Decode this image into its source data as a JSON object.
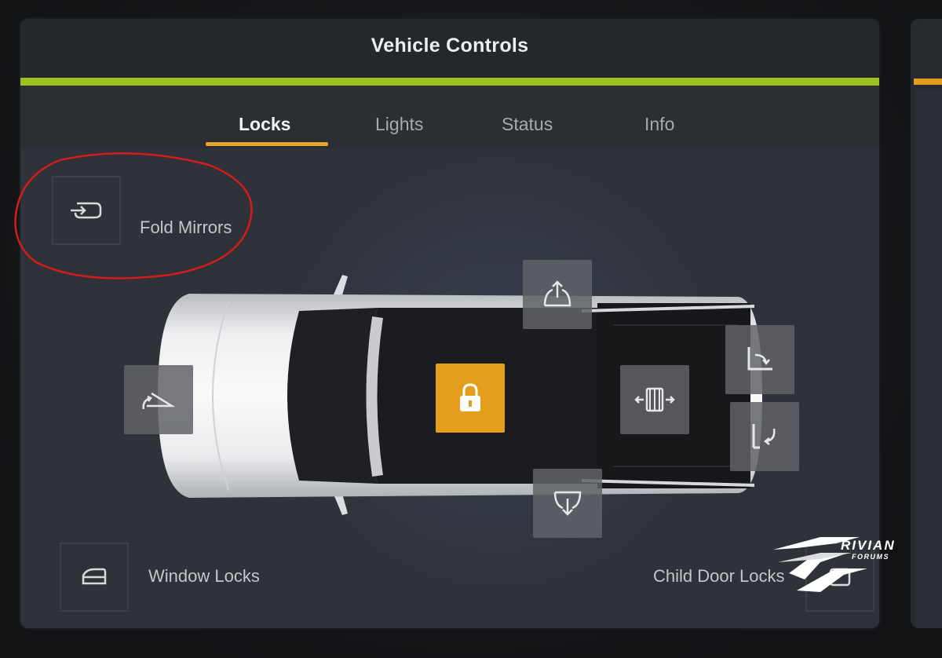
{
  "window": {
    "title": "Vehicle Controls"
  },
  "colors": {
    "accent_bar": "#9bc224",
    "tab_underline": "#e4a529",
    "lock_button": "#e59e1c",
    "annotation_circle": "#d41c1c"
  },
  "tabs": [
    {
      "label": "Locks",
      "active": true
    },
    {
      "label": "Lights",
      "active": false
    },
    {
      "label": "Status",
      "active": false
    },
    {
      "label": "Info",
      "active": false
    }
  ],
  "controls": {
    "fold_mirrors": {
      "label": "Fold Mirrors",
      "icon": "mirror-fold-icon"
    },
    "window_locks": {
      "label": "Window Locks",
      "icon": "window-lock-icon"
    },
    "child_door_locks": {
      "label": "Child Door Locks",
      "icon": "child-door-lock-icon"
    },
    "frunk": {
      "icon": "frunk-open-icon"
    },
    "lock": {
      "icon": "padlock-icon"
    },
    "gear_tunnel": {
      "icon": "gear-tunnel-icon"
    },
    "tonneau_up": {
      "icon": "tailgate-open-icon"
    },
    "tailgate": {
      "icon": "tailgate-drop-icon"
    },
    "window_up": {
      "icon": "window-up-icon"
    },
    "window_down": {
      "icon": "window-down-icon"
    }
  },
  "watermark": {
    "line1": "RIVIAN",
    "line2": "FORUMS"
  }
}
